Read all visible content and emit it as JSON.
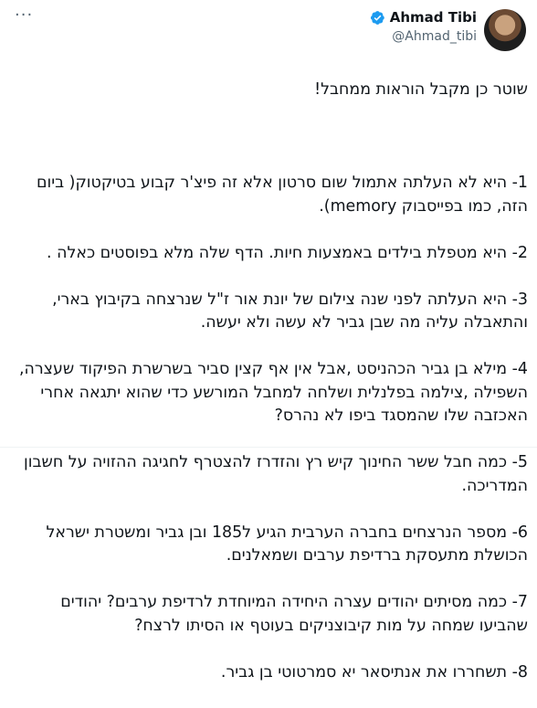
{
  "tweet": {
    "author_name": "Ahmad Tibi",
    "author_handle": "@Ahmad_tibi",
    "more_label": "···",
    "title": "שוטר כן מקבל הוראות ממחבל!",
    "items": [
      "1- היא לא העלתה אתמול שום סרטון אלא זה פיצ'ר קבוע בטיקטוק( ביום הזה, כמו  בפייסבוק memory).",
      "2- היא מטפלת בילדים באמצעות חיות. הדף שלה מלא בפוסטים כאלה .",
      "3- היא העלתה לפני שנה  צילום של יונת אור ז\"ל שנרצחה בקיבוץ בארי, והתאבלה עליה מה שבן גביר לא עשה ולא יעשה.",
      "4- מילא בן גביר הכהניסט ,אבל אין אף קצין סביר בשרשרת הפיקוד שעצרה, השפילה ,צילמה בפלנלית ושלחה למחבל המורשע כדי שהוא יתגאה אחרי האכזבה שלו שהמסגד ביפו לא נהרס?",
      "5- כמה חבל ששר החינוך קיש רץ והזדרז להצטרף לחגיגה ההזויה על חשבון המדריכה.",
      "6- מספר הנרצחים בחברה הערבית הגיע ל185 ובן גביר ומשטרת ישראל הכושלת מתעסקת ברדיפת ערבים ושמאלנים.",
      "7- כמה מסיתים יהודים עצרה היחידה  המיוחדת לרדיפת ערבים? יהודים שהביעו שמחה על מות קיבוצניקים בעוטף או הסיתו לרצח?",
      "8- תשחררו את אנתיסאר יא סמרטוטי בן גביר."
    ]
  }
}
